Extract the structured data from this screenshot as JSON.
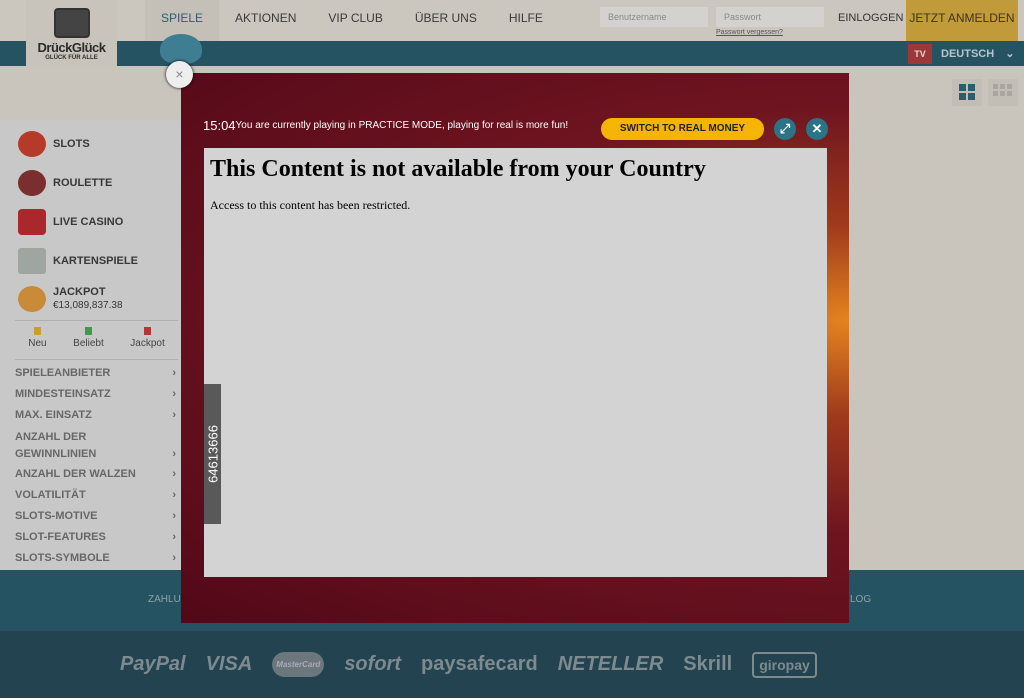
{
  "header": {
    "logo": {
      "name": "DrückGlück",
      "tagline": "GLÜCK FÜR ALLE"
    },
    "nav": [
      "SPIELE",
      "AKTIONEN",
      "VIP CLUB",
      "ÜBER UNS",
      "HILFE"
    ],
    "username_placeholder": "Benutzername",
    "password_placeholder": "Passwort",
    "forgot": "Passwort vergessen?",
    "login": "EINLOGGEN",
    "register": "JETZT ANMELDEN",
    "tv": "TV",
    "language": "DEUTSCH"
  },
  "sidebar": {
    "categories": [
      "SLOTS",
      "ROULETTE",
      "LIVE CASINO",
      "KARTENSPIELE"
    ],
    "jackpot": {
      "label": "JACKPOT",
      "amount": "€13,089,837.38"
    },
    "tags": [
      {
        "label": "Neu",
        "color": "#c9a02c"
      },
      {
        "label": "Beliebt",
        "color": "#3f9a4e"
      },
      {
        "label": "Jackpot",
        "color": "#b03838"
      }
    ],
    "filters": [
      "SPIELEANBIETER",
      "MINDESTEINSATZ",
      "MAX. EINSATZ",
      "ANZAHL DER GEWINNLINIEN",
      "ANZAHL DER WALZEN",
      "VOLATILITÄT",
      "SLOTS-MOTIVE",
      "SLOT-FEATURES",
      "SLOTS-SYMBOLE"
    ]
  },
  "footer": {
    "left": "ZAHLU",
    "right": "LOG",
    "payments": [
      "PayPal",
      "VISA",
      "MasterCard",
      "sofort",
      "paysafecard",
      "NETELLER",
      "Skrill",
      "giropay"
    ]
  },
  "modal": {
    "time": "15:04",
    "message": "You are currently playing in PRACTICE MODE, playing for real is more fun!",
    "switch_label": "SWITCH TO REAL MONEY",
    "content_title": "This Content is not available from your Country",
    "content_text": "Access to this content has been restricted.",
    "id_tag": "64613666"
  }
}
